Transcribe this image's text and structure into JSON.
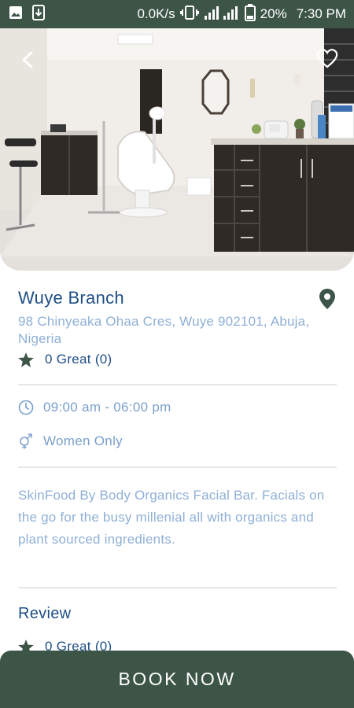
{
  "status_bar": {
    "speed": "0.0K/s",
    "battery": "20%",
    "time": "7:30 PM"
  },
  "branch": {
    "name": "Wuye Branch",
    "address": "98 Chinyeaka Ohaa Cres, Wuye 902101, Abuja, Nigeria",
    "rating": "0 Great (0)"
  },
  "details": {
    "hours": "09:00 am - 06:00 pm",
    "audience": "Women Only"
  },
  "description": "SkinFood By Body Organics Facial Bar. Facials on the go for the busy millenial all with organics and plant sourced ingredients.",
  "review": {
    "title": "Review",
    "rating": "0 Great (0)"
  },
  "actions": {
    "book_label": "BOOK NOW"
  },
  "colors": {
    "primary_green": "#3d5547",
    "title_blue": "#1f4f86",
    "muted_blue": "#8fb0d6"
  },
  "icons": [
    "image-icon",
    "download-icon",
    "vibrate-icon",
    "signal-icon",
    "battery-icon",
    "back-arrow-icon",
    "heart-icon",
    "map-pin-icon",
    "star-icon",
    "clock-icon",
    "gender-icon"
  ]
}
